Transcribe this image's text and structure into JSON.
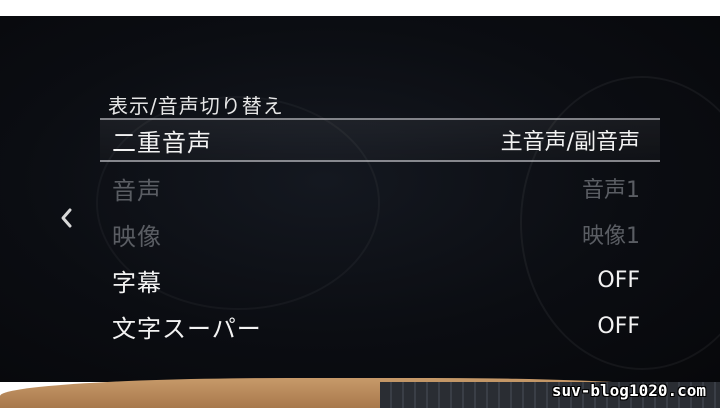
{
  "menu": {
    "title": "表示/音声切り替え",
    "items": [
      {
        "label": "二重音声",
        "value": "主音声/副音声"
      },
      {
        "label": "音声",
        "value": "音声1"
      },
      {
        "label": "映像",
        "value": "映像1"
      },
      {
        "label": "字幕",
        "value": "OFF"
      },
      {
        "label": "文字スーパー",
        "value": "OFF"
      }
    ]
  },
  "watermark": "suv-blog1020.com",
  "icons": {
    "back": "chevron-left-icon"
  },
  "colors": {
    "text": "#f2f2f2",
    "disabled": "#5a5d63",
    "background": "#0b0d12"
  }
}
